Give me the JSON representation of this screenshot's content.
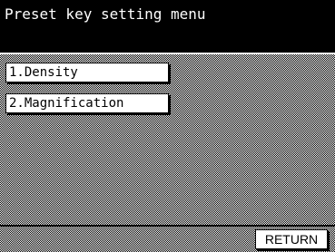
{
  "header": {
    "title": "Preset key setting menu"
  },
  "menu": {
    "items": [
      {
        "label": "1.Density"
      },
      {
        "label": "2.Magnification"
      }
    ]
  },
  "footer": {
    "return_label": "RETURN"
  }
}
